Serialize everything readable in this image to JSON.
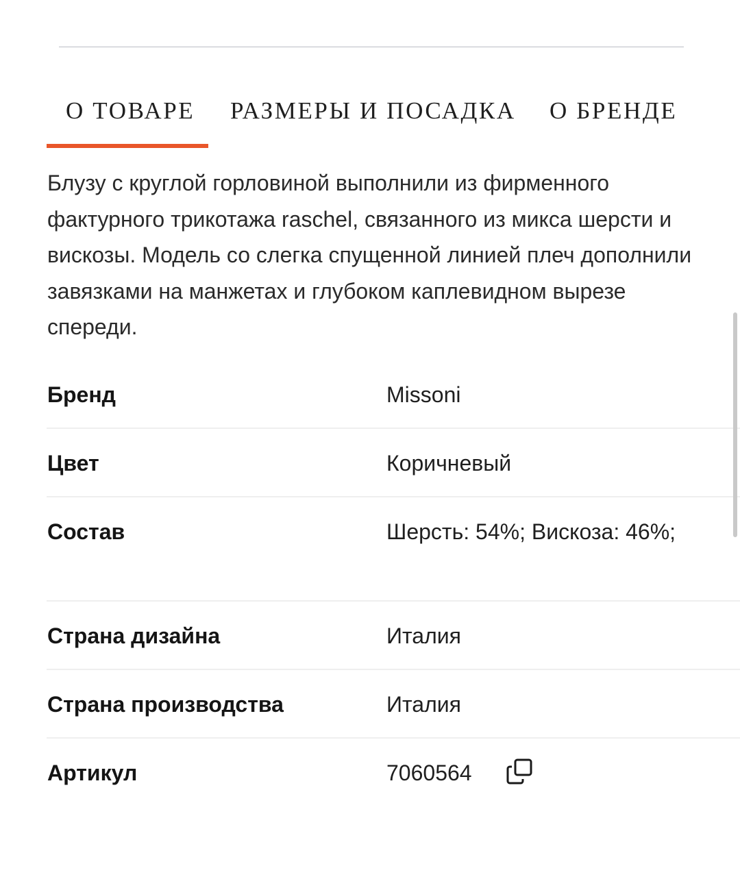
{
  "tabs": [
    {
      "label": "О ТОВАРЕ",
      "active": true
    },
    {
      "label": "РАЗМЕРЫ И ПОСАДКА",
      "active": false
    },
    {
      "label": "О БРЕНДЕ",
      "active": false
    }
  ],
  "description": "Блузу с круглой горловиной выполнили из фирменного фактурного трикотажа raschel, связанного из микса шерсти и вискозы. Модель со слегка спущенной линией плеч дополнили завязками на манжетах и глубоком каплевидном вырезе спереди.",
  "specs": [
    {
      "label": "Бренд",
      "value": "Missoni"
    },
    {
      "label": "Цвет",
      "value": "Коричневый"
    },
    {
      "label": "Состав",
      "value": "Шерсть: 54%; Вискоза: 46%;"
    },
    {
      "label": "Страна дизайна",
      "value": "Италия"
    },
    {
      "label": "Страна производства",
      "value": "Италия"
    },
    {
      "label": "Артикул",
      "value": "7060564"
    }
  ],
  "icons": {
    "copy": "copy-icon"
  },
  "colors": {
    "accent": "#e9562a",
    "divider": "#efefef",
    "text": "#1a1a1a"
  }
}
